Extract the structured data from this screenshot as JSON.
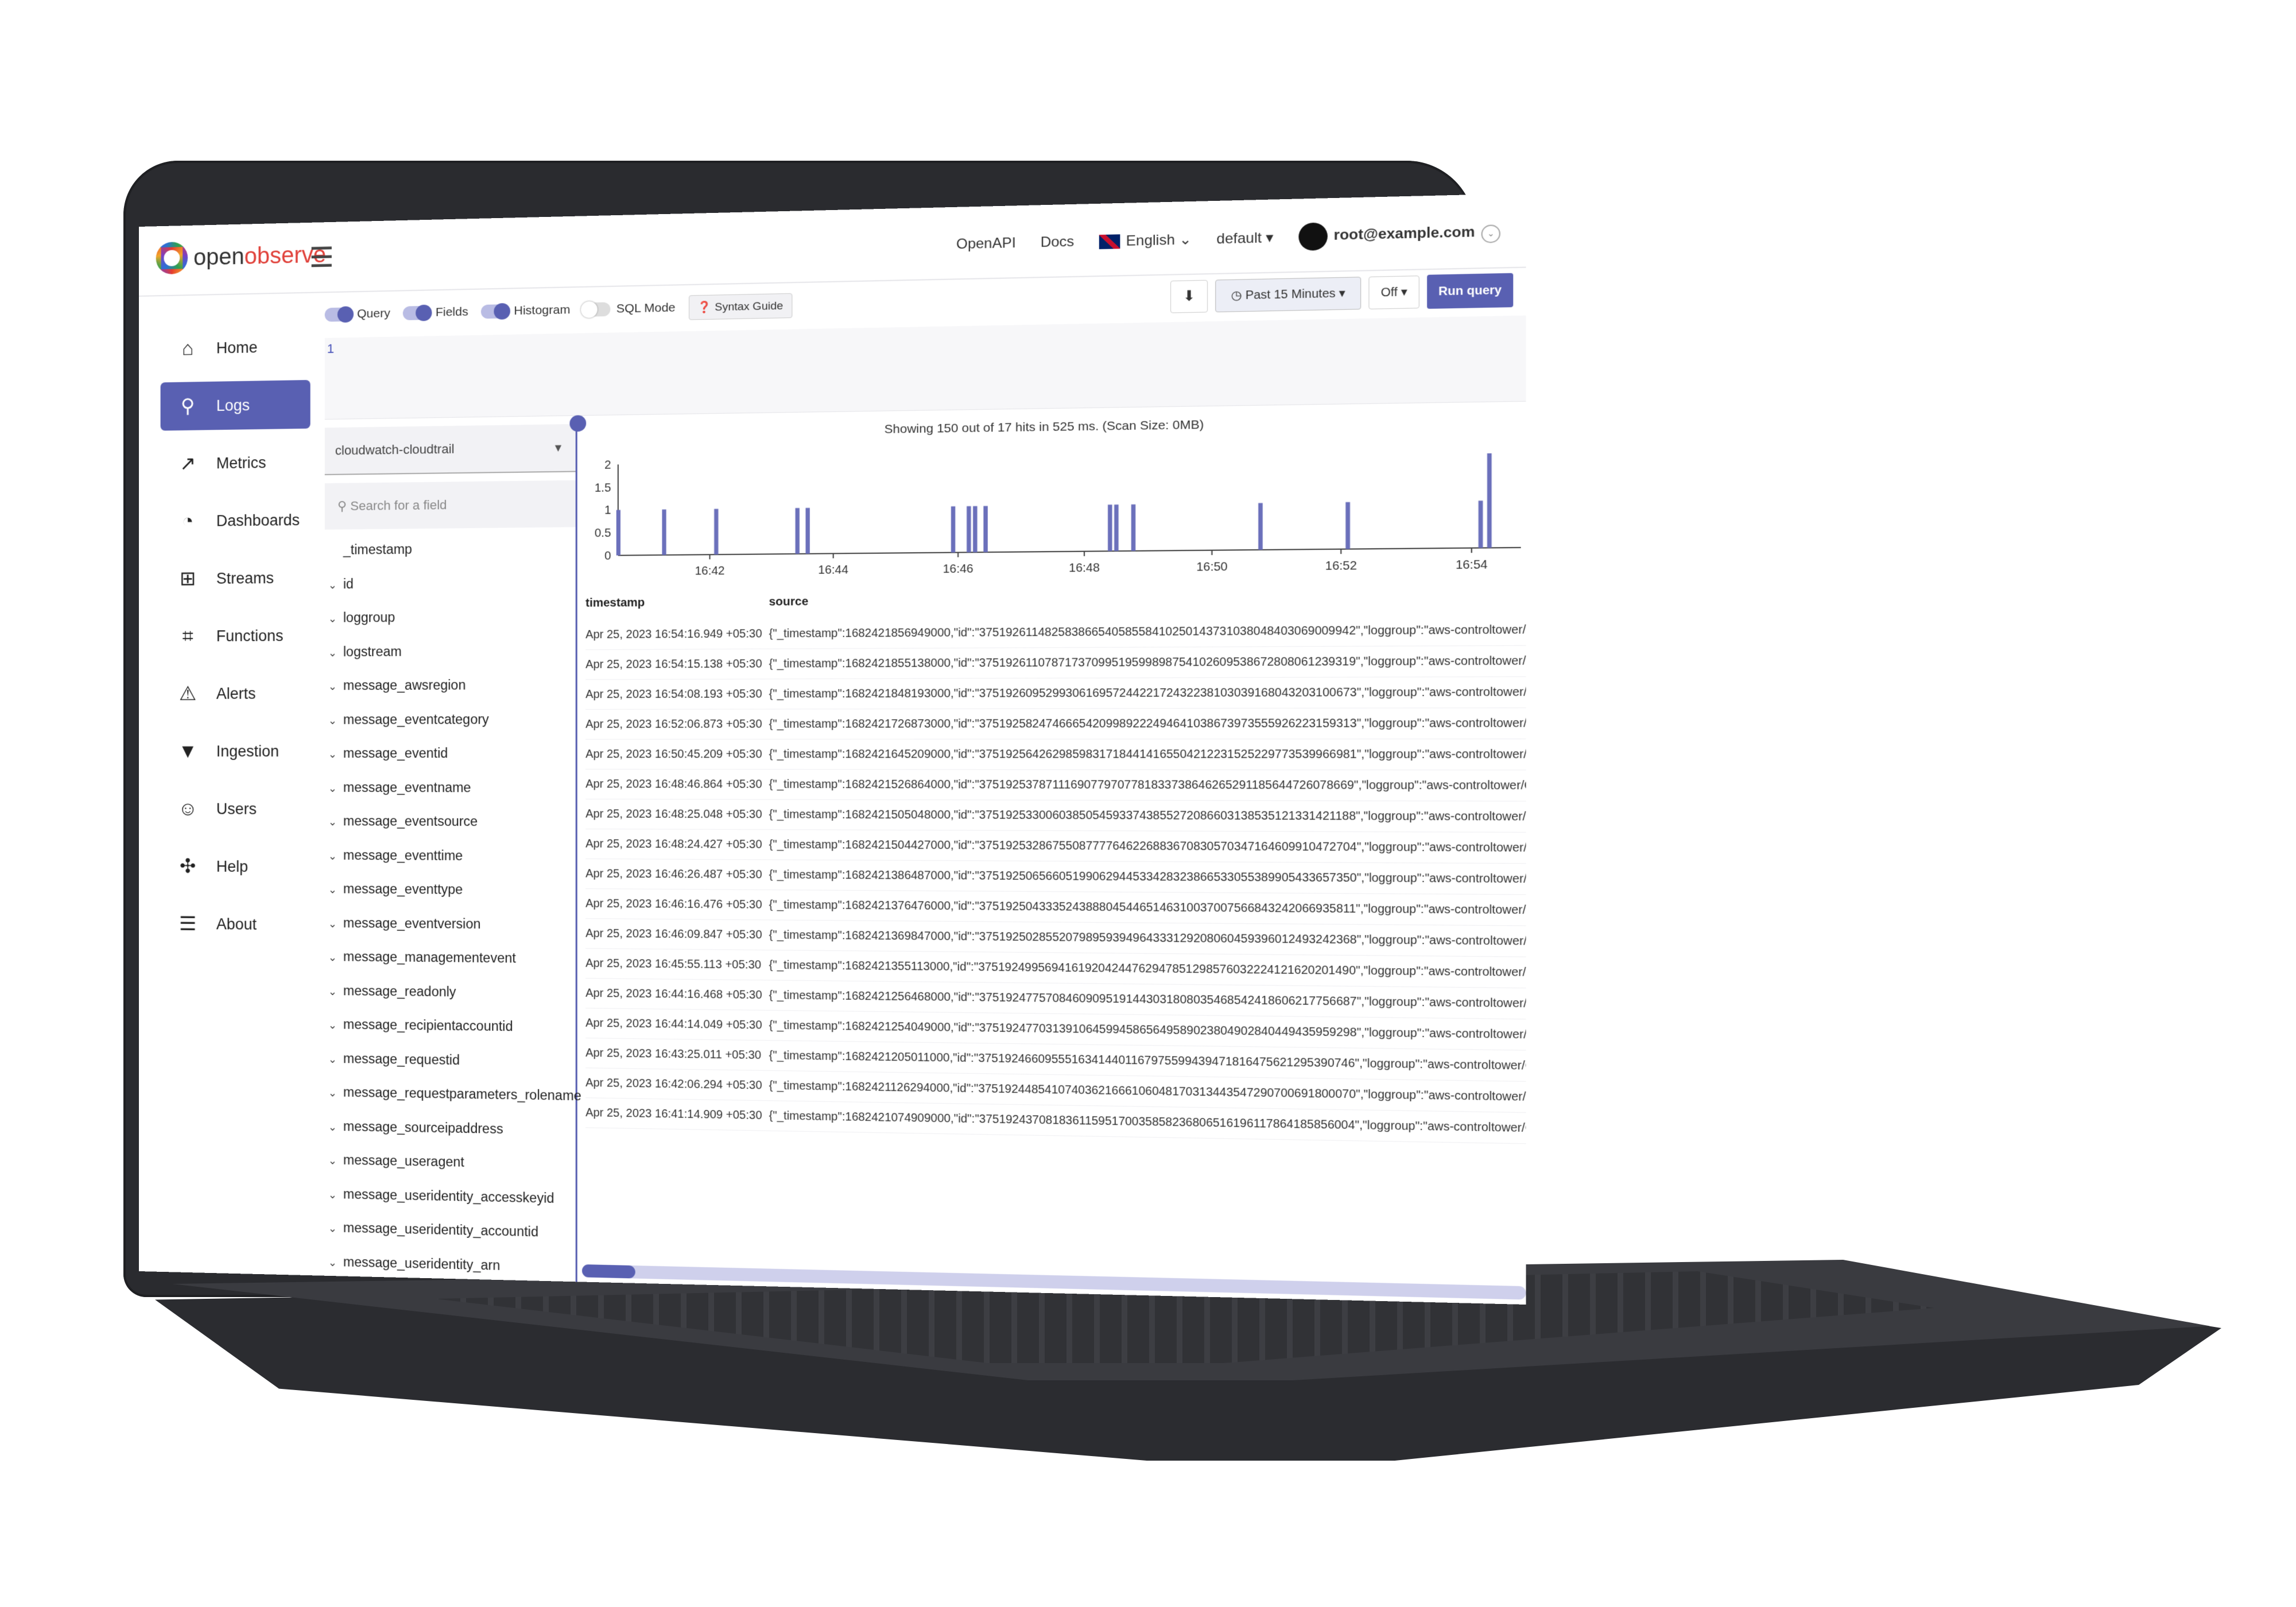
{
  "app": {
    "brand_open": "open",
    "brand_observe": "observe"
  },
  "header": {
    "openapi": "OpenAPI",
    "docs": "Docs",
    "language": "English",
    "org": "default",
    "user": "root@example.com"
  },
  "sidebar": {
    "items": [
      {
        "label": "Home",
        "icon": "home-icon"
      },
      {
        "label": "Logs",
        "icon": "search-icon",
        "active": true
      },
      {
        "label": "Metrics",
        "icon": "line-chart-icon"
      },
      {
        "label": "Dashboards",
        "icon": "gauge-icon"
      },
      {
        "label": "Streams",
        "icon": "grid-icon"
      },
      {
        "label": "Functions",
        "icon": "crop-icon"
      },
      {
        "label": "Alerts",
        "icon": "warning-icon"
      },
      {
        "label": "Ingestion",
        "icon": "filter-icon"
      },
      {
        "label": "Users",
        "icon": "user-icon"
      },
      {
        "label": "Help",
        "icon": "slack-icon"
      },
      {
        "label": "About",
        "icon": "list-icon"
      }
    ]
  },
  "toolbar": {
    "query": "Query",
    "fields": "Fields",
    "histogram": "Histogram",
    "sql_mode": "SQL Mode",
    "syntax_guide": "Syntax Guide",
    "time_range": "Past 15 Minutes",
    "refresh": "Off",
    "run": "Run query"
  },
  "editor": {
    "line": "1"
  },
  "fields_panel": {
    "stream": "cloudwatch-cloudtrail",
    "search_placeholder": "Search for a field",
    "fields": [
      "_timestamp",
      "id",
      "loggroup",
      "logstream",
      "message_awsregion",
      "message_eventcategory",
      "message_eventid",
      "message_eventname",
      "message_eventsource",
      "message_eventtime",
      "message_eventtype",
      "message_eventversion",
      "message_managementevent",
      "message_readonly",
      "message_recipientaccountid",
      "message_requestid",
      "message_requestparameters_rolename",
      "message_sourceipaddress",
      "message_useragent",
      "message_useridentity_accesskeyid",
      "message_useridentity_accountid",
      "message_useridentity_arn"
    ]
  },
  "results": {
    "summary": "Showing 150 out of 17 hits in 525 ms. (Scan Size: 0MB)",
    "col_timestamp": "timestamp",
    "col_source": "source",
    "rows": [
      {
        "ts": "Apr 25, 2023 16:54:16.949 +05:30",
        "src": "{\"_timestamp\":1682421856949000,\"id\":\"37519261148258386654058558410250143731038048403069009942\",\"loggroup\":\"aws-controltower/CloudTrail"
      },
      {
        "ts": "Apr 25, 2023 16:54:15.138 +05:30",
        "src": "{\"_timestamp\":1682421855138000,\"id\":\"37519261107871737099519599898754102609538672808061239319\",\"loggroup\":\"aws-controltower/CloudTrail"
      },
      {
        "ts": "Apr 25, 2023 16:54:08.193 +05:30",
        "src": "{\"_timestamp\":1682421848193000,\"id\":\"37519260952993061695724422172432238103039168043203100673\",\"loggroup\":\"aws-controltower/CloudTrail"
      },
      {
        "ts": "Apr 25, 2023 16:52:06.873 +05:30",
        "src": "{\"_timestamp\":1682421726873000,\"id\":\"37519258247466654209989222494641038673973555926223159313\",\"loggroup\":\"aws-controltower/CloudTrail"
      },
      {
        "ts": "Apr 25, 2023 16:50:45.209 +05:30",
        "src": "{\"_timestamp\":1682421645209000,\"id\":\"37519256426298598317184414165504212231525229773539966981\",\"loggroup\":\"aws-controltower/CloudTrail"
      },
      {
        "ts": "Apr 25, 2023 16:48:46.864 +05:30",
        "src": "{\"_timestamp\":1682421526864000,\"id\":\"37519253787111690779707781833738646265291185644726078669\",\"loggroup\":\"aws-controltower/CloudTrail"
      },
      {
        "ts": "Apr 25, 2023 16:48:25.048 +05:30",
        "src": "{\"_timestamp\":1682421505048000,\"id\":\"37519253300603850545933743855272086603138535121331421188\",\"loggroup\":\"aws-controltower/CloudTrail"
      },
      {
        "ts": "Apr 25, 2023 16:48:24.427 +05:30",
        "src": "{\"_timestamp\":1682421504427000,\"id\":\"37519253286755087777646226883670830570347164609910472704\",\"loggroup\":\"aws-controltower/CloudTrail"
      },
      {
        "ts": "Apr 25, 2023 16:46:26.487 +05:30",
        "src": "{\"_timestamp\":1682421386487000,\"id\":\"37519250656605199062944533428323866533055389905433657350\",\"loggroup\":\"aws-controltower/CloudTrail"
      },
      {
        "ts": "Apr 25, 2023 16:46:16.476 +05:30",
        "src": "{\"_timestamp\":1682421376476000,\"id\":\"37519250433352438880454465146310037007566843242066935811\",\"loggroup\":\"aws-controltower/CloudTrail"
      },
      {
        "ts": "Apr 25, 2023 16:46:09.847 +05:30",
        "src": "{\"_timestamp\":1682421369847000,\"id\":\"37519250285520798959394964333129208060459396012493242368\",\"loggroup\":\"aws-controltower/CloudTrail"
      },
      {
        "ts": "Apr 25, 2023 16:45:55.113 +05:30",
        "src": "{\"_timestamp\":1682421355113000,\"id\":\"37519249956941619204244762947851298576032224121620201490\",\"loggroup\":\"aws-controltower/CloudTrail"
      },
      {
        "ts": "Apr 25, 2023 16:44:16.468 +05:30",
        "src": "{\"_timestamp\":1682421256468000,\"id\":\"37519247757084609095191443031808035468542418606217756687\",\"loggroup\":\"aws-controltower/CloudTrail"
      },
      {
        "ts": "Apr 25, 2023 16:44:14.049 +05:30",
        "src": "{\"_timestamp\":1682421254049000,\"id\":\"37519247703139106459945865649589023804902840449435959298\",\"loggroup\":\"aws-controltower/CloudTrail"
      },
      {
        "ts": "Apr 25, 2023 16:43:25.011 +05:30",
        "src": "{\"_timestamp\":1682421205011000,\"id\":\"37519246609555163414401167975599439471816475621295390746\",\"loggroup\":\"aws-controltower/CloudTrail"
      },
      {
        "ts": "Apr 25, 2023 16:42:06.294 +05:30",
        "src": "{\"_timestamp\":1682421126294000,\"id\":\"37519244854107403621666106048170313443547290700691800070\",\"loggroup\":\"aws-controltower/CloudTrail"
      },
      {
        "ts": "Apr 25, 2023 16:41:14.909 +05:30",
        "src": "{\"_timestamp\":1682421074909000,\"id\":\"37519243708183611595170035858236806516196117864185856004\",\"loggroup\":\"aws-controltower/CloudTrail"
      }
    ]
  },
  "colors": {
    "accent": "#5960b2",
    "bar": "#6b70bb"
  },
  "chart_data": {
    "type": "bar",
    "xlabel": "",
    "ylabel": "",
    "ylim": [
      0,
      2
    ],
    "yticks": [
      "0",
      "0.5",
      "1",
      "1.5",
      "2"
    ],
    "xticks": [
      "16:42",
      "16:44",
      "16:46",
      "16:48",
      "16:50",
      "16:52",
      "16:54"
    ],
    "x": [
      "16:40:30",
      "16:41:15",
      "16:42:06",
      "16:43:25",
      "16:43:35",
      "16:45:55",
      "16:46:10",
      "16:46:16",
      "16:46:26",
      "16:48:24",
      "16:48:30",
      "16:48:46",
      "16:50:45",
      "16:52:06",
      "16:54:08",
      "16:54:16"
    ],
    "values": [
      1,
      1,
      1,
      1,
      1,
      1,
      1,
      1,
      1,
      1,
      1,
      1,
      1,
      1,
      1,
      2
    ]
  }
}
